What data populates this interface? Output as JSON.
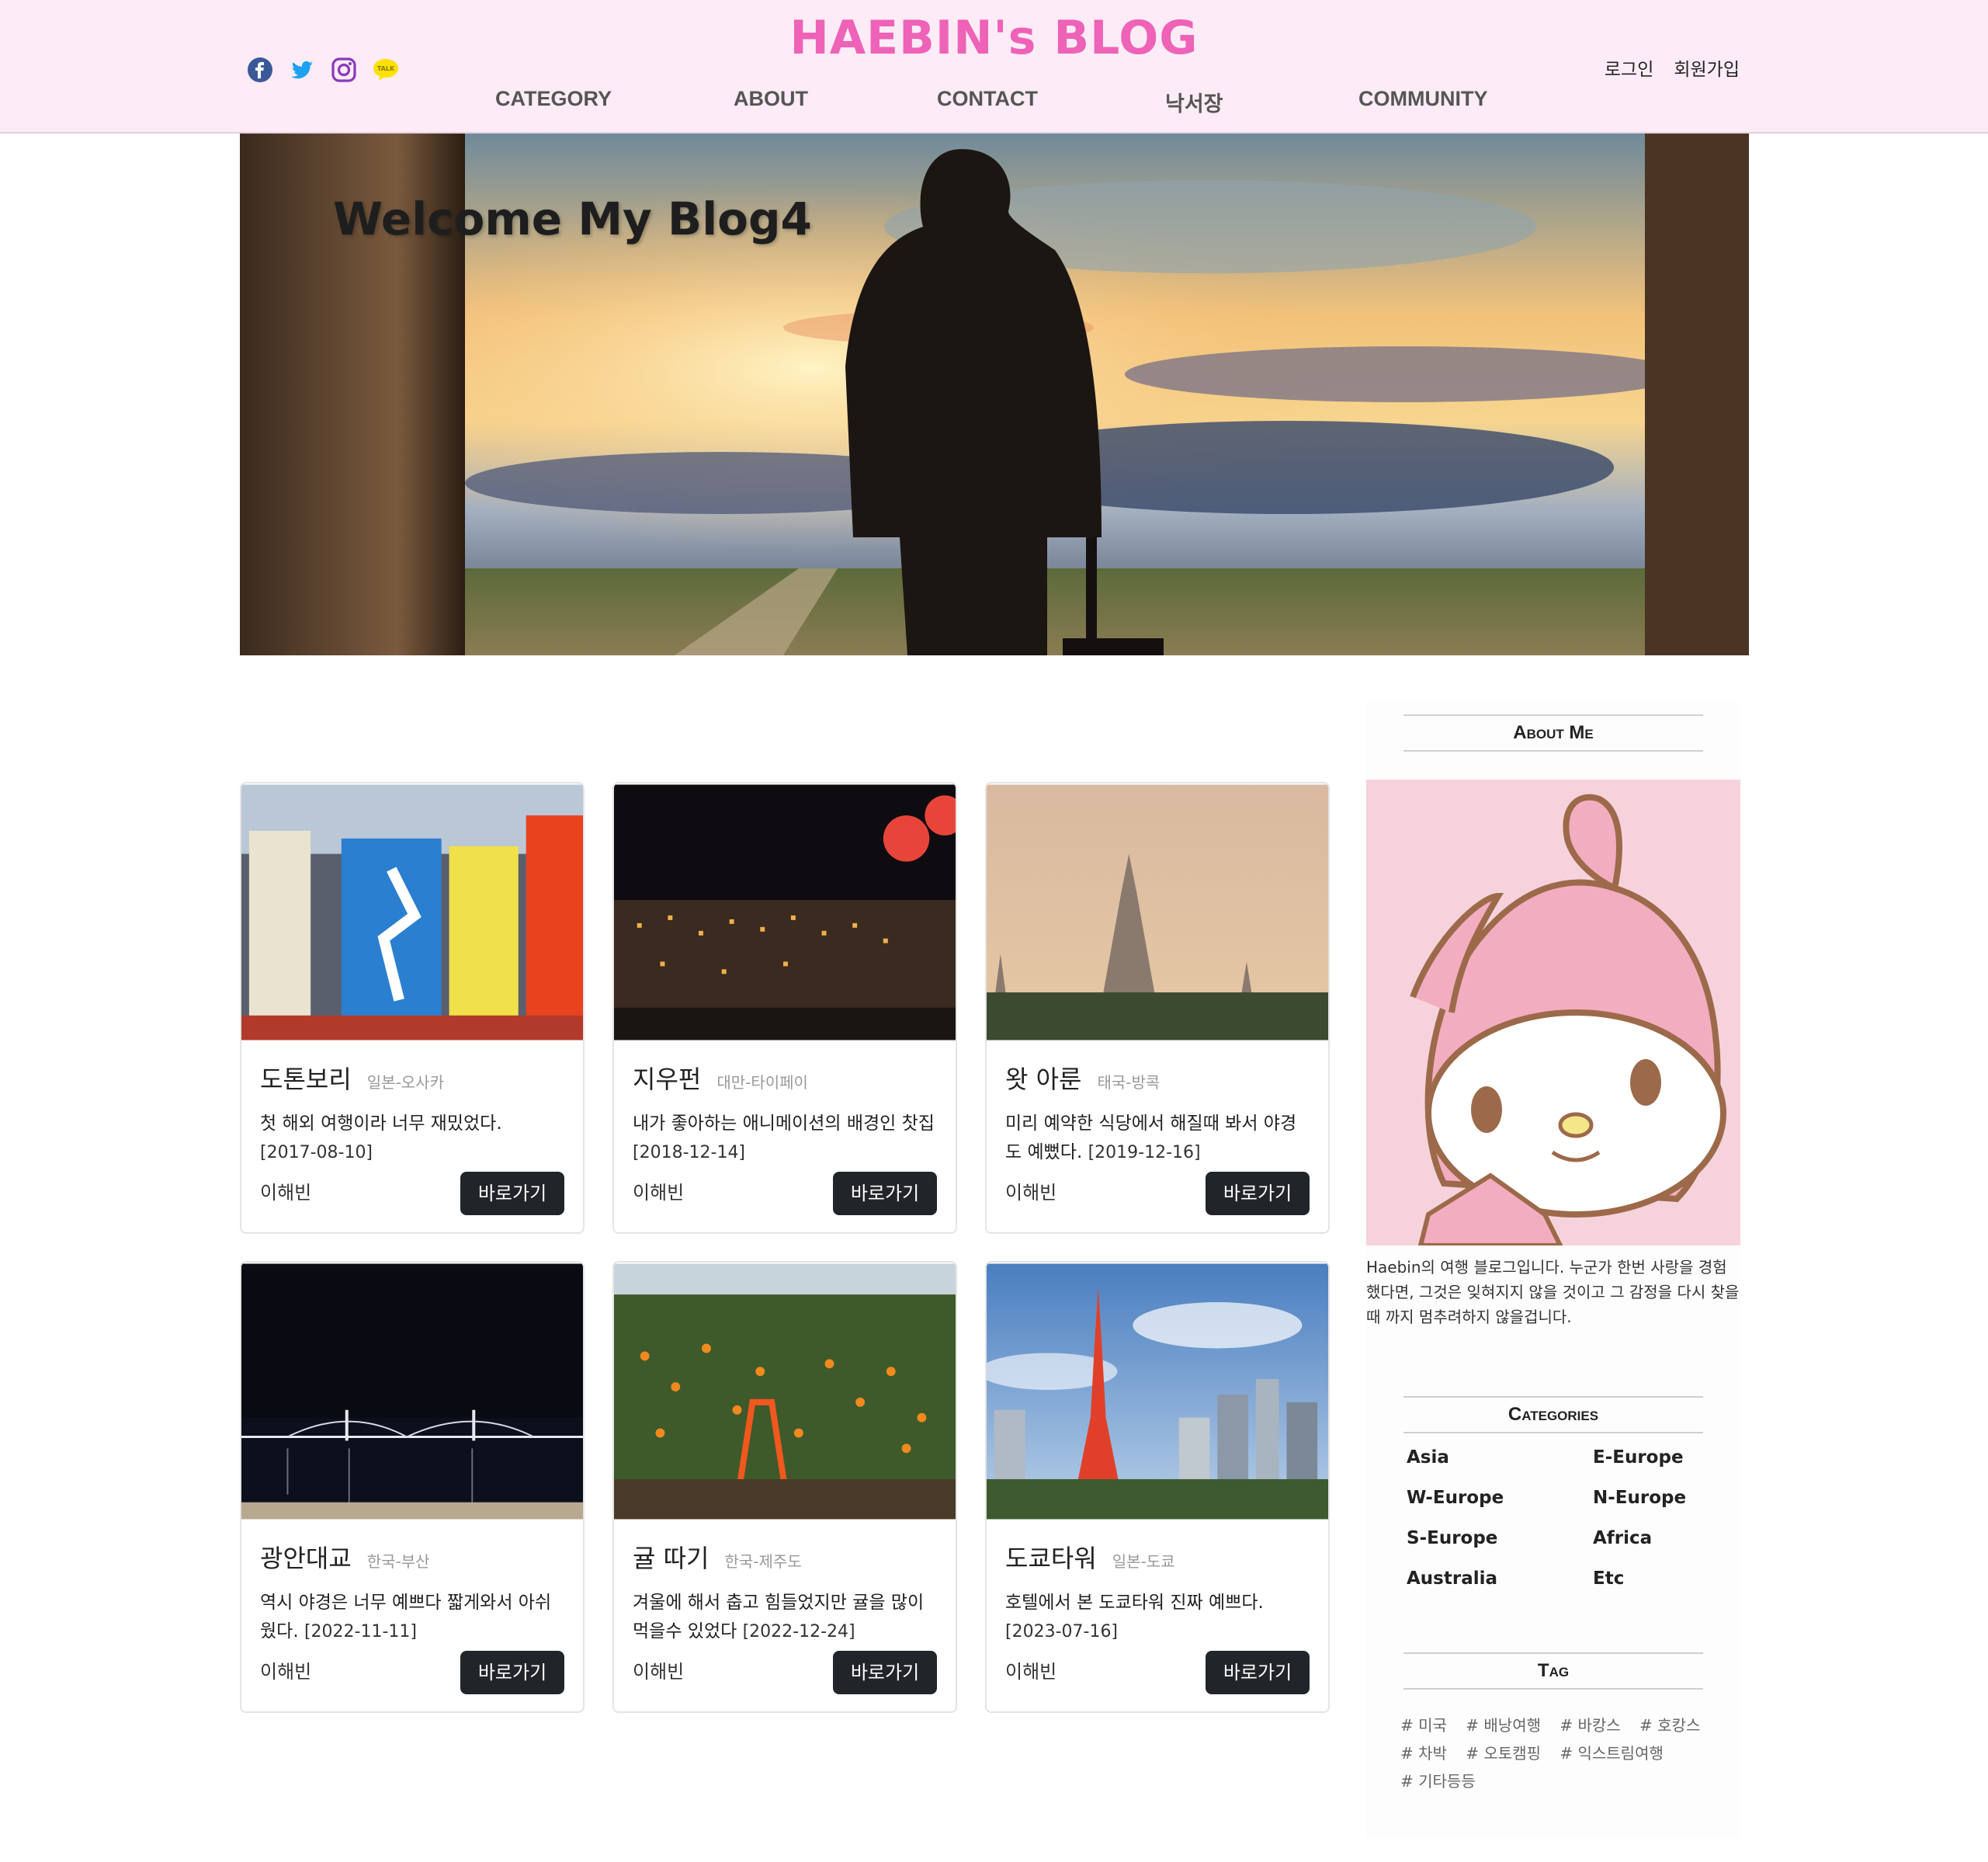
{
  "header": {
    "brand": "HAEBIN's BLOG",
    "social": [
      "facebook-icon",
      "twitter-icon",
      "instagram-icon",
      "kakaotalk-icon"
    ],
    "kakao_label": "TALK",
    "nav": [
      "CATEGORY",
      "ABOUT",
      "CONTACT",
      "낙서장",
      "COMMUNITY"
    ],
    "login": "로그인",
    "signup": "회원가입"
  },
  "hero": {
    "title": "Welcome My Blog4"
  },
  "cards": [
    {
      "title": "도톤보리",
      "region": "일본-오사카",
      "text": "첫 해외 여행이라 너무 재밌었다.",
      "date": "[2017-08-10]",
      "author": "이해빈",
      "button": "바로가기"
    },
    {
      "title": "지우펀",
      "region": "대만-타이페이",
      "text": "내가 좋아하는 애니메이션의 배경인 찻집",
      "date": "[2018-12-14]",
      "author": "이해빈",
      "button": "바로가기"
    },
    {
      "title": "왓 아룬",
      "region": "태국-방콕",
      "text": "미리 예약한 식당에서 해질때 봐서 야경도 예뻤다.",
      "date": "[2019-12-16]",
      "author": "이해빈",
      "button": "바로가기"
    },
    {
      "title": "광안대교",
      "region": "한국-부산",
      "text": "역시 야경은 너무 예쁘다 짧게와서 아쉬웠다.",
      "date": "[2022-11-11]",
      "author": "이해빈",
      "button": "바로가기"
    },
    {
      "title": "귤 따기",
      "region": "한국-제주도",
      "text": "겨울에 해서 춥고 힘들었지만 귤을 많이 먹을수 있었다",
      "date": "[2022-12-24]",
      "author": "이해빈",
      "button": "바로가기"
    },
    {
      "title": "도쿄타워",
      "region": "일본-도쿄",
      "text": "호텔에서 본 도쿄타워 진짜 예쁘다.",
      "date": "[2023-07-16]",
      "author": "이해빈",
      "button": "바로가기"
    }
  ],
  "sidebar": {
    "about_heading": "About Me",
    "about_text": "Haebin의 여행 블로그입니다. 누군가 한번 사랑을 경험했다면, 그것은 잊혀지지 않을 것이고 그 감정을 다시 찾을 때 까지 멈추려하지 않을겁니다.",
    "categories_heading": "Categories",
    "categories": [
      "Asia",
      "E-Europe",
      "W-Europe",
      "N-Europe",
      "S-Europe",
      "Africa",
      "Australia",
      "Etc"
    ],
    "tag_heading": "Tag",
    "tags": [
      "# 미국",
      "# 배낭여행",
      "# 바캉스",
      "# 호캉스",
      "# 차박",
      "# 오토캠핑",
      "# 익스트림여행",
      "# 기타등등"
    ]
  },
  "colors": {
    "header_bg": "#fdebf6",
    "brand": "#ee62b8",
    "button": "#212529"
  }
}
